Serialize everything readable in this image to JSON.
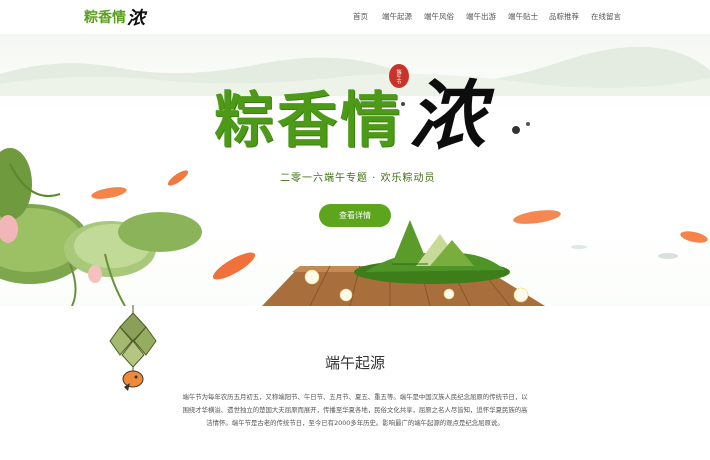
{
  "logo": {
    "green_text": "粽香情",
    "ink_text": "浓"
  },
  "nav": {
    "items": [
      {
        "label": "首页"
      },
      {
        "label": "端午起源"
      },
      {
        "label": "端午风俗"
      },
      {
        "label": "端午出游"
      },
      {
        "label": "端午贴士"
      },
      {
        "label": "品粽推荐"
      },
      {
        "label": "在线留言"
      }
    ]
  },
  "hero": {
    "title_green": "粽香情",
    "title_ink": "浓",
    "seal_text": "端午节",
    "subtitle": "二零一六端午专题 · 欢乐粽动员",
    "button_label": "查看详情"
  },
  "section": {
    "title": "端午起源",
    "paragraph": "端午节为每年农历五月初五，又称端阳节、午日节、五月节、夏五、重五等。端午是中国汉族人民纪念屈原的传统节日，以围绕才华横溢、遗世独立的楚国大夫屈原而展开，传播至华夏各地，民俗文化共享，屈原之名人尽皆知，追怀华夏民族的高洁情怀。端午节是古老的传统节日，至今已有2000多年历史。影响最广的端午起源的观点是纪念屈原说。"
  },
  "icons": {
    "zongzi": "zongzi-icon",
    "koi": "koi-fish-icon",
    "lotus": "lotus-leaf-icon"
  },
  "colors": {
    "brand_green": "#5da51d",
    "title_green": "#4d9a18",
    "koi_orange": "#f0713a",
    "seal_red": "#c8342b"
  }
}
